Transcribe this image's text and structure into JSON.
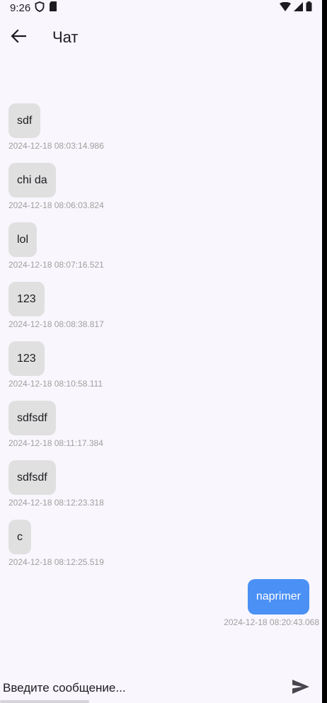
{
  "status_bar": {
    "time": "9:26"
  },
  "app_bar": {
    "title": "Чат",
    "back_icon": "arrow-left-icon"
  },
  "messages": [
    {
      "direction": "in",
      "text": "sdf",
      "timestamp": "2024-12-18 08:03:14.986"
    },
    {
      "direction": "in",
      "text": "chi da",
      "timestamp": "2024-12-18 08:06:03.824"
    },
    {
      "direction": "in",
      "text": "lol",
      "timestamp": "2024-12-18 08:07:16.521"
    },
    {
      "direction": "in",
      "text": "123",
      "timestamp": "2024-12-18 08:08:38.817"
    },
    {
      "direction": "in",
      "text": "123",
      "timestamp": "2024-12-18 08:10:58.111"
    },
    {
      "direction": "in",
      "text": "sdfsdf",
      "timestamp": "2024-12-18 08:11:17.384"
    },
    {
      "direction": "in",
      "text": "sdfsdf",
      "timestamp": "2024-12-18 08:12:23.318"
    },
    {
      "direction": "in",
      "text": "c",
      "timestamp": "2024-12-18 08:12:25.519"
    },
    {
      "direction": "out",
      "text": "naprimer",
      "timestamp": "2024-12-18 08:20:43.068"
    }
  ],
  "composer": {
    "placeholder": "Введите сообщение...",
    "value": "",
    "send_icon": "send-icon"
  },
  "colors": {
    "background": "#f9f7fd",
    "incoming_bubble": "#e0e0e0",
    "outgoing_bubble": "#4a90f5",
    "timestamp": "#9e9e9e"
  }
}
